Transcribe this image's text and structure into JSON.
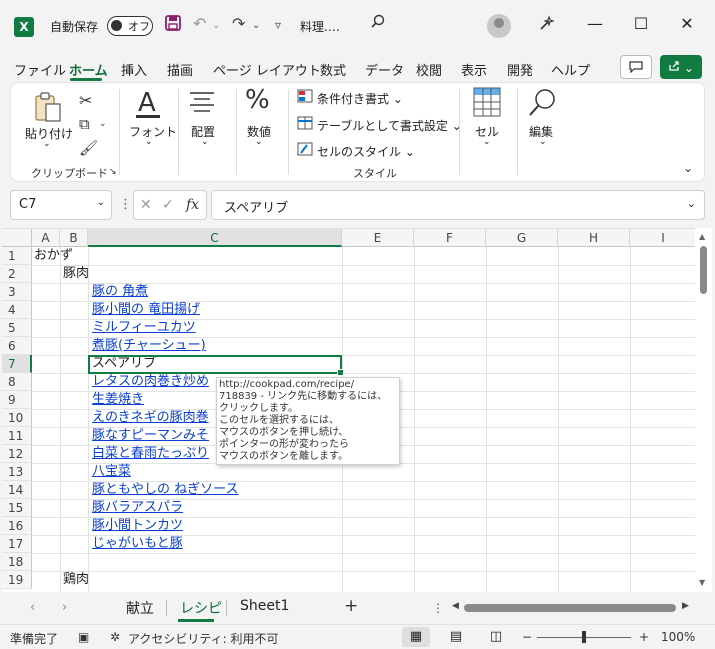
{
  "titlebar": {
    "autosave_label": "自動保存",
    "autosave_state": "オフ",
    "filename": "料理.…",
    "save_icon": "save-icon",
    "undo_icon": "undo-icon",
    "redo_icon": "redo-icon",
    "search_icon": "search-icon",
    "min": "—",
    "max": "☐",
    "close": "✕"
  },
  "menu": {
    "items": [
      "ファイル",
      "ホーム",
      "挿入",
      "描画",
      "ページ レイアウト",
      "数式",
      "データ",
      "校閲",
      "表示",
      "開発",
      "ヘルプ"
    ],
    "active": "ホーム"
  },
  "ribbon": {
    "paste": "貼り付け",
    "font": "フォント",
    "alignment": "配置",
    "number": "数値",
    "conditional": "条件付き書式",
    "table_format": "テーブルとして書式設定",
    "cell_style": "セルのスタイル",
    "cells": "セル",
    "editing": "編集",
    "group_clipboard": "クリップボード",
    "group_style": "スタイル"
  },
  "formula_bar": {
    "name_box": "C7",
    "fx": "fx",
    "content": "スペアリブ"
  },
  "columns": [
    "A",
    "B",
    "C",
    "E",
    "F",
    "G",
    "H",
    "I"
  ],
  "rows": [
    "1",
    "2",
    "3",
    "4",
    "5",
    "6",
    "7",
    "8",
    "9",
    "10",
    "11",
    "12",
    "13",
    "14",
    "15",
    "16",
    "17",
    "18",
    "19"
  ],
  "cells": {
    "r1": "おかず",
    "r2": "豚肉",
    "r3": "豚の 角煮",
    "r4": "豚小間の 竜田揚げ",
    "r5": "ミルフィーユカツ",
    "r6": "煮豚(チャーシュー)",
    "r7": "スペアリブ",
    "r8": "レタスの肉巻き炒め",
    "r9": "生姜焼き",
    "r10": "えのきネギの豚肉巻",
    "r11": "豚なすピーマンみそ",
    "r12": "白菜と春雨たっぷり",
    "r13": "八宝菜",
    "r14": "豚ともやしの ねぎソース",
    "r15": "豚バラアスパラ",
    "r16": "豚小間トンカツ",
    "r17": "じゃがいもと豚",
    "r19": "鶏肉"
  },
  "tooltip": {
    "line1": "http://cookpad.com/recipe/",
    "line2": "718839 - リンク先に移動するには、",
    "line3": "クリックします。",
    "line4": "このセルを選択するには、",
    "line5": "マウスのボタンを押し続け、",
    "line6": "ポインターの形が変わったら",
    "line7": "マウスのボタンを離します。"
  },
  "tabs": {
    "items": [
      "献立",
      "レシピ",
      "Sheet1"
    ],
    "active": "レシピ",
    "add": "+"
  },
  "status": {
    "ready": "準備完了",
    "accessibility": "アクセシビリティ: 利用不可",
    "zoom": "100%",
    "minus": "−",
    "plus": "+"
  },
  "colors": {
    "accent": "#107c41",
    "link": "#0b3fd1"
  }
}
